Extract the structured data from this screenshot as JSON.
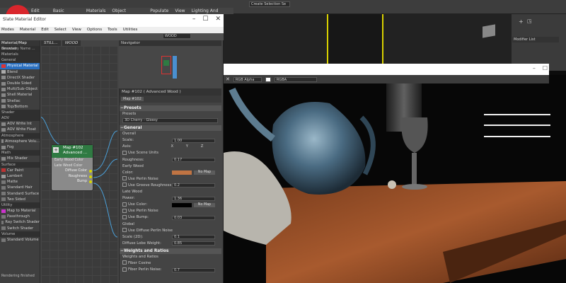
{
  "app": {
    "ribbon": [
      "Edit",
      "Tools",
      "Group",
      "Views",
      "Create",
      "Modifiers",
      "Animation",
      "Graph Editors",
      "Rendering",
      "Civil View",
      "Customize",
      "Scripting",
      "Content"
    ],
    "ribbon_tabs": [
      "Edit Poly",
      "Basic Modeling",
      "Materials",
      "Object Placement",
      "Populate",
      "View",
      "Lighting And Rendering"
    ],
    "selection_set": "Create Selection Se",
    "modifier_list": "Modifier List"
  },
  "editor": {
    "title": "Slate Material Editor",
    "menu": [
      "Modes",
      "Material",
      "Edit",
      "Select",
      "View",
      "Options",
      "Tools",
      "Utilities"
    ],
    "view_tabs": [
      "STILL...",
      "WOOD"
    ],
    "view_dropdown": "WOOD",
    "navigator_title": "Navigator",
    "browser": {
      "title": "Material/Map Browser",
      "search": "Search by Name ...",
      "items": [
        {
          "label": "Materials",
          "cat": true
        },
        {
          "label": "General",
          "cat": true
        },
        {
          "label": "Physical Material",
          "selected": true,
          "color": "#d33"
        },
        {
          "label": "Blend",
          "color": "#aaa"
        },
        {
          "label": "DirectX Shader",
          "color": "#888"
        },
        {
          "label": "Double Sided",
          "color": "#888"
        },
        {
          "label": "Multi/Sub-Object",
          "color": "#888"
        },
        {
          "label": "Shell Material",
          "color": "#888"
        },
        {
          "label": "Shellac",
          "color": "#888"
        },
        {
          "label": "Top/Bottom",
          "color": "#888"
        },
        {
          "label": "Shader",
          "cat": true
        },
        {
          "label": "AOV",
          "cat": true
        },
        {
          "label": "AOV Write Int",
          "color": "#888"
        },
        {
          "label": "AOV Write Float",
          "color": "#888"
        },
        {
          "label": "Atmosphere",
          "cat": true
        },
        {
          "label": "Atmosphere Volu...",
          "color": "#888"
        },
        {
          "label": "Fog",
          "color": "#888"
        },
        {
          "label": "Math",
          "cat": true
        },
        {
          "label": "Mix Shader",
          "color": "#888"
        },
        {
          "label": "Surface",
          "cat": true
        },
        {
          "label": "Car Paint",
          "color": "#b33"
        },
        {
          "label": "Lambert",
          "color": "#999"
        },
        {
          "label": "Matte",
          "color": "#777"
        },
        {
          "label": "Standard Hair",
          "color": "#777"
        },
        {
          "label": "Standard Surface",
          "color": "#777"
        },
        {
          "label": "Two Sided",
          "color": "#777"
        },
        {
          "label": "Utility",
          "cat": true
        },
        {
          "label": "Map to Material",
          "color": "#c3c"
        },
        {
          "label": "Passthrough",
          "color": "#777"
        },
        {
          "label": "Ray Switch Shader",
          "color": "#777"
        },
        {
          "label": "Switch Shader",
          "color": "#777"
        },
        {
          "label": "Volume",
          "cat": true
        },
        {
          "label": "Standard Volume",
          "color": "#777"
        }
      ],
      "footer": "Rendering finished"
    },
    "node": {
      "title": "Map #102",
      "subtitle": "Advanced ...",
      "inputs": [
        "Early Wood Color",
        "Late Wood Color"
      ],
      "outputs": [
        "Diffuse Color",
        "Roughness",
        "Bump"
      ]
    },
    "params": {
      "title": "Map #102  ( Advanced Wood )",
      "tab": "Map #102",
      "presets": {
        "header": "Presets",
        "label": "Presets",
        "value": "3D Cherry - Glossy"
      },
      "general": {
        "header": "General",
        "overall": "Overall",
        "scale_label": "Scale:",
        "scale": "1.00",
        "axis_label": "Axis:",
        "axis_x": "X",
        "axis_y": "Y",
        "axis_z": "Z",
        "use_scene_units": "Use Scene Units",
        "roughness_label": "Roughness:",
        "roughness": "0.17"
      },
      "early": {
        "header": "Early Wood",
        "color_label": "Color:",
        "color": "#c07443",
        "nomap": "No Map",
        "use_perlin": "Use Perlin Noise",
        "use_groove": "Use Groove Roughness",
        "groove": "0.2"
      },
      "late": {
        "header": "Late Wood",
        "power_label": "Power:",
        "power": "1.36",
        "use_color": "Use Color:",
        "color": "#000000",
        "nomap": "No Map",
        "use_perlin": "Use Perlin Noise",
        "use_bump": "Use Bump:",
        "bump": "0.03"
      },
      "global": {
        "header": "Global",
        "use_diffuse_perlin": "Use Diffuse Perlin Noise",
        "scale2d_label": "Scale (2D):",
        "scale2d": "0.1",
        "lobe_label": "Diffuse Lobe Weight:",
        "lobe": "0.85"
      },
      "weights": {
        "header": "Weights and Ratios",
        "sub": "Weights and Ratios",
        "fiber_cosine": "Fiber Cosine",
        "fiber_perlin": "Fiber Perlin Noise:",
        "fiber_perlin_val": "0.7"
      }
    }
  },
  "render": {
    "channel": "RGB Alpha",
    "mode": "RGBA"
  },
  "colors": {
    "accent": "#2a6fbf",
    "node_header": "#2f7a42",
    "slot_dot": "#d6d600",
    "brand": "#d9262c"
  }
}
